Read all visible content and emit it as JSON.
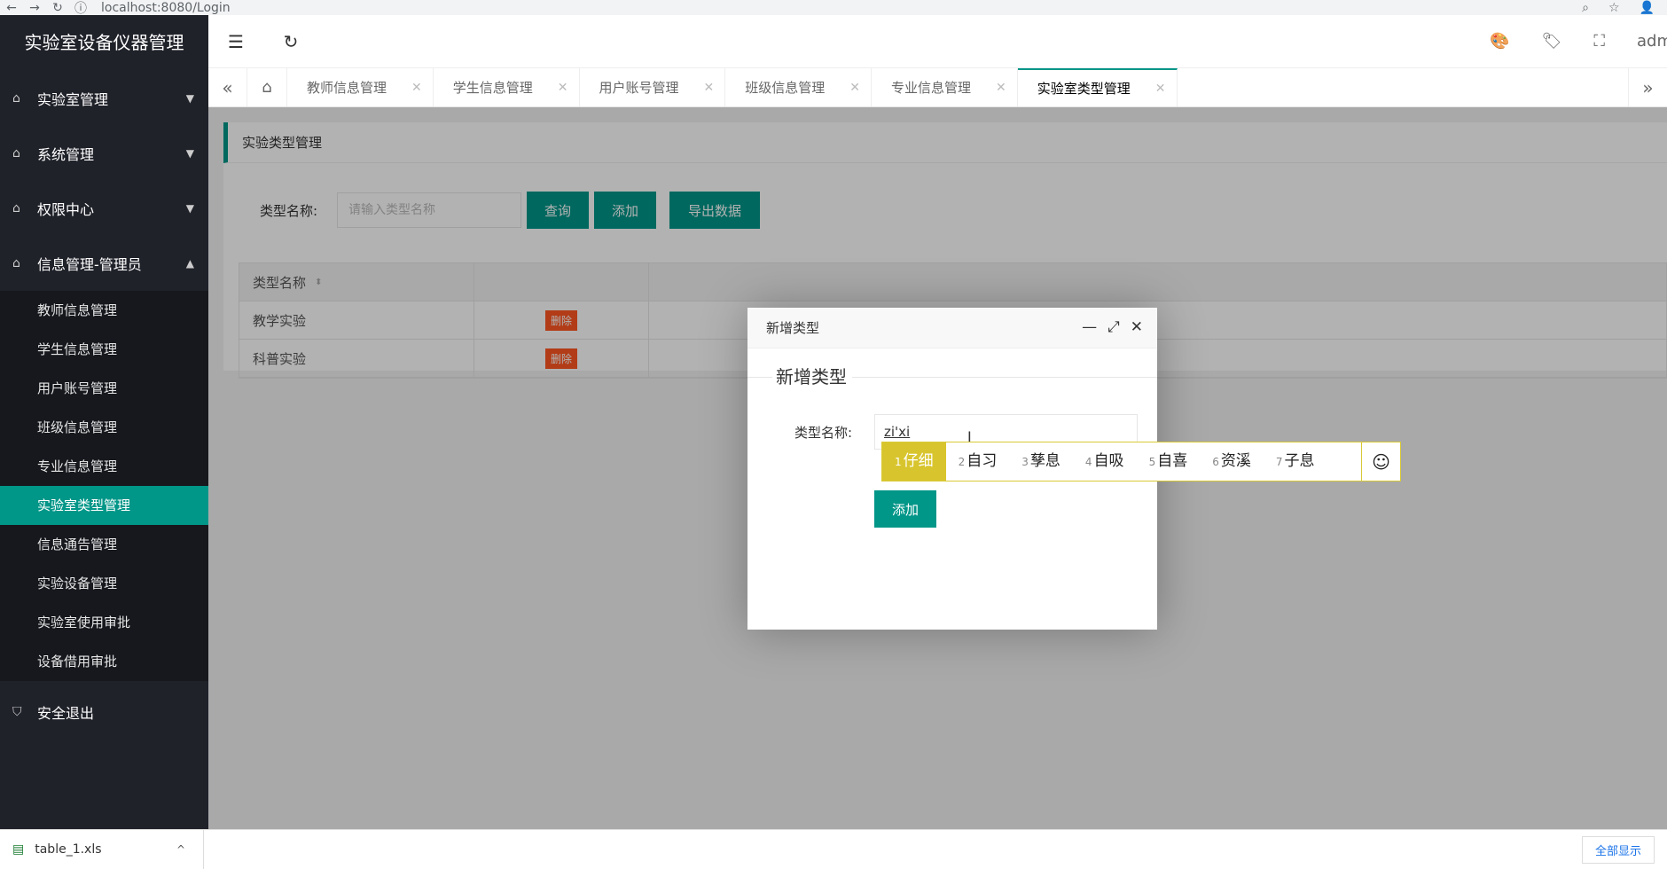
{
  "browser": {
    "url": "localhost:8080/Login",
    "back": "←",
    "forward": "→",
    "reload": "↻",
    "info": "ⓘ",
    "zoom": "⌕",
    "star": "☆",
    "account": "👤"
  },
  "sidebar": {
    "logo": "实验室设备仪器管理",
    "groups": [
      {
        "label": "实验室管理",
        "icon": "⌂",
        "caret": "▼"
      },
      {
        "label": "系统管理",
        "icon": "⌂",
        "caret": "▼"
      },
      {
        "label": "权限中心",
        "icon": "⌂",
        "caret": "▼"
      },
      {
        "label": "信息管理-管理员",
        "icon": "⌂",
        "caret": "▲"
      }
    ],
    "items": [
      {
        "label": "教师信息管理"
      },
      {
        "label": "学生信息管理"
      },
      {
        "label": "用户账号管理"
      },
      {
        "label": "班级信息管理"
      },
      {
        "label": "专业信息管理"
      },
      {
        "label": "实验室类型管理"
      },
      {
        "label": "信息通告管理"
      },
      {
        "label": "实验设备管理"
      },
      {
        "label": "实验室使用审批"
      },
      {
        "label": "设备借用审批"
      }
    ],
    "logout": {
      "label": "安全退出",
      "icon": "⛉"
    }
  },
  "header": {
    "menu_icon": "☰",
    "refresh_icon": "↻",
    "theme_icon": "🎨",
    "tag_icon": "🏷",
    "fullscreen_icon": "⛶",
    "user": "admin"
  },
  "tabs": {
    "prev": "«",
    "home": "⌂",
    "next": "»",
    "close": "✕",
    "items": [
      {
        "label": "教师信息管理"
      },
      {
        "label": "学生信息管理"
      },
      {
        "label": "用户账号管理"
      },
      {
        "label": "班级信息管理"
      },
      {
        "label": "专业信息管理"
      },
      {
        "label": "实验室类型管理"
      }
    ]
  },
  "card": {
    "title": "实验类型管理",
    "search_label": "类型名称:",
    "search_placeholder": "请输入类型名称",
    "btn_query": "查询",
    "btn_add": "添加",
    "btn_export": "导出数据"
  },
  "table": {
    "header": "类型名称",
    "sort_icon": "⬍",
    "rows": [
      {
        "name": "教学实验",
        "action": "删除"
      },
      {
        "name": "科普实验",
        "action": "删除"
      }
    ]
  },
  "modal": {
    "title": "新增类型",
    "min": "—",
    "max": "⤢",
    "close": "✕",
    "legend": "新增类型",
    "label": "类型名称:",
    "input_value": "zi'xi",
    "cursor": "I",
    "btn_add": "添加"
  },
  "ime": {
    "candidates": [
      {
        "n": "1",
        "text": "仔细"
      },
      {
        "n": "2",
        "text": "自习"
      },
      {
        "n": "3",
        "text": "孳息"
      },
      {
        "n": "4",
        "text": "自吸"
      },
      {
        "n": "5",
        "text": "自喜"
      },
      {
        "n": "6",
        "text": "资溪"
      },
      {
        "n": "7",
        "text": "子息"
      }
    ],
    "emoji": "☺"
  },
  "download": {
    "file": "table_1.xls",
    "file_icon": "▤",
    "chevron": "^",
    "show_all": "全部显示"
  }
}
